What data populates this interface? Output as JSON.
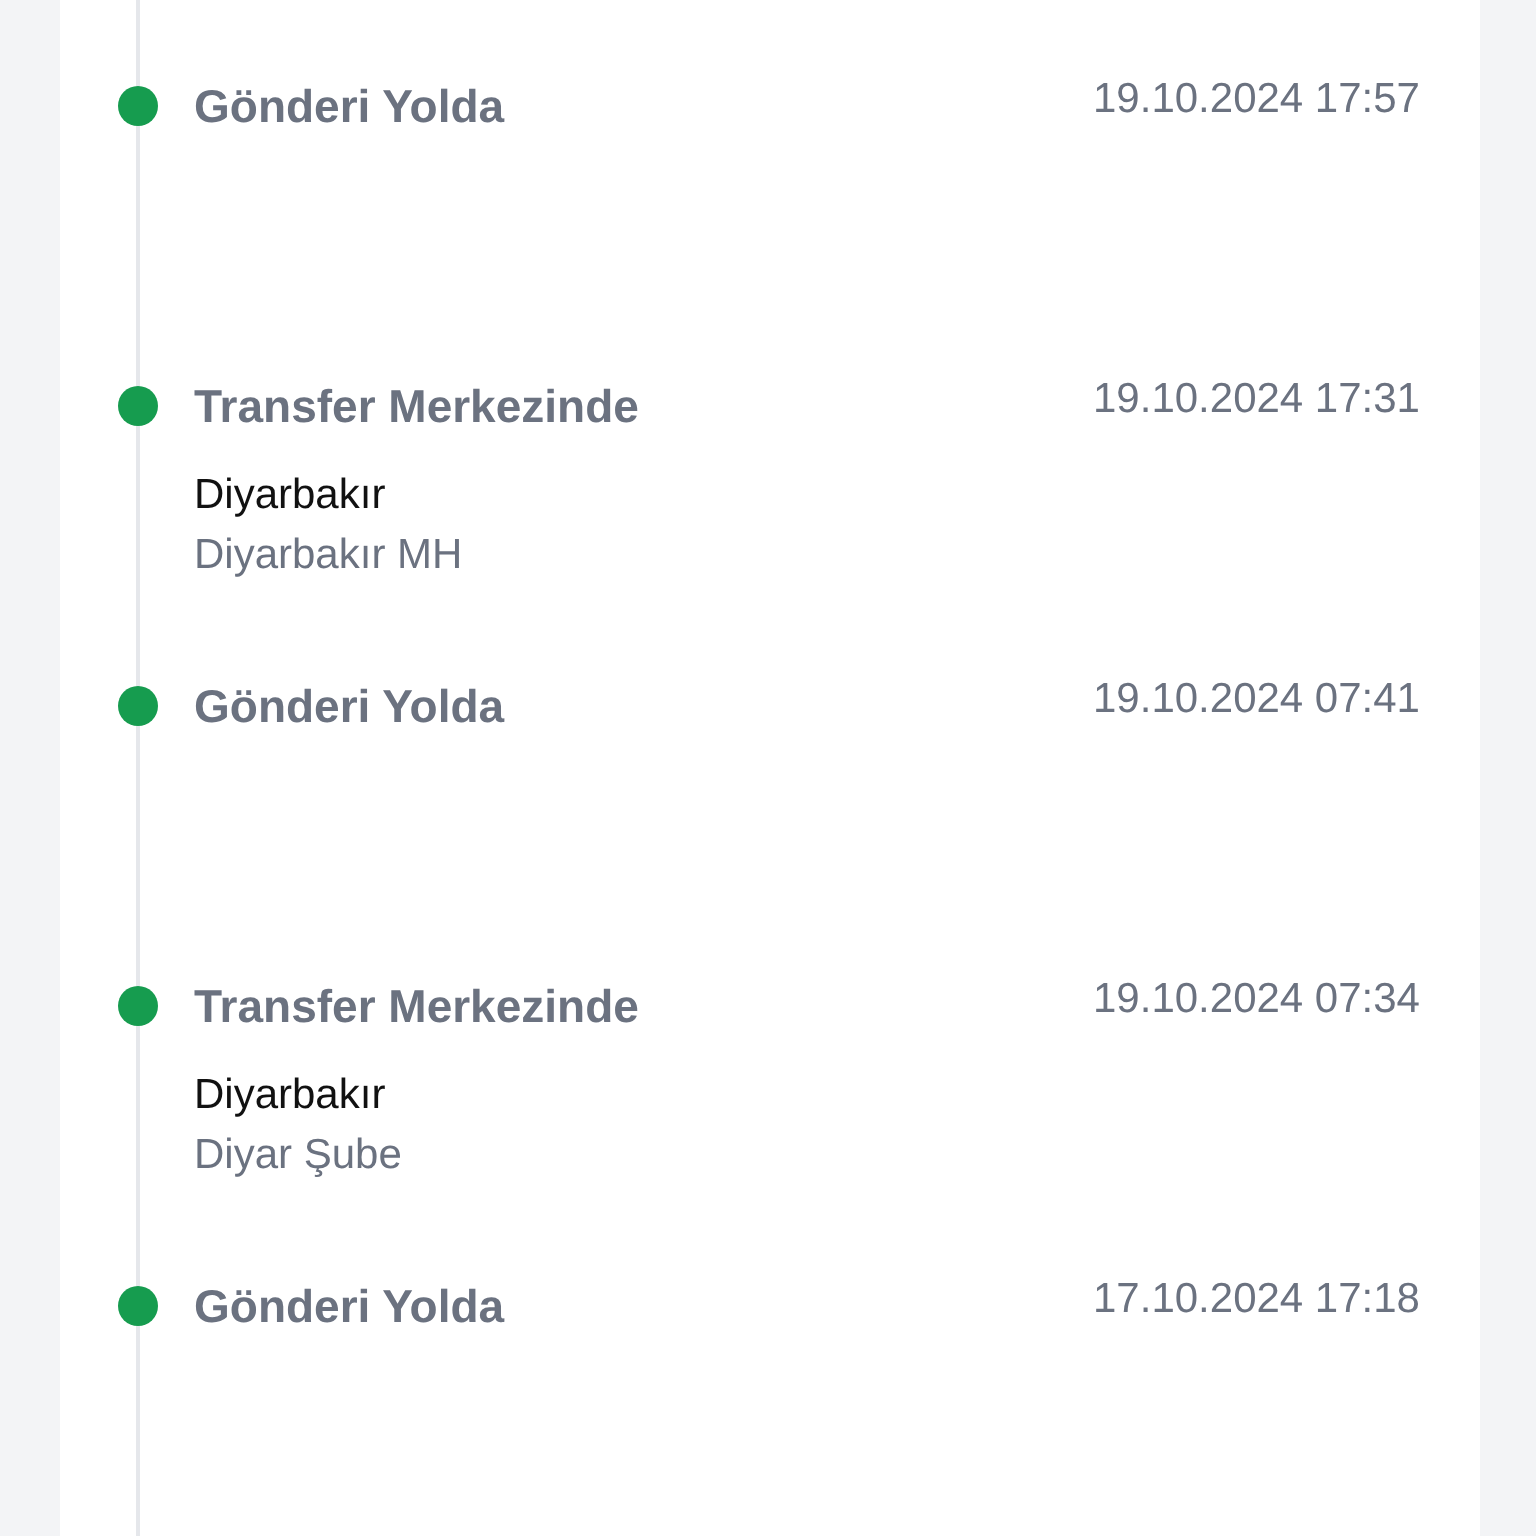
{
  "events": [
    {
      "title": "Gönderi Yolda",
      "date": "19.10.2024 17:57"
    },
    {
      "title": "Transfer Merkezinde",
      "date": "19.10.2024 17:31",
      "city": "Diyarbakır",
      "branch": "Diyarbakır MH"
    },
    {
      "title": "Gönderi Yolda",
      "date": "19.10.2024 07:41"
    },
    {
      "title": "Transfer Merkezinde",
      "date": "19.10.2024 07:34",
      "city": "Diyarbakır",
      "branch": "Diyar Şube"
    },
    {
      "title": "Gönderi Yolda",
      "date": "17.10.2024 17:18"
    }
  ]
}
